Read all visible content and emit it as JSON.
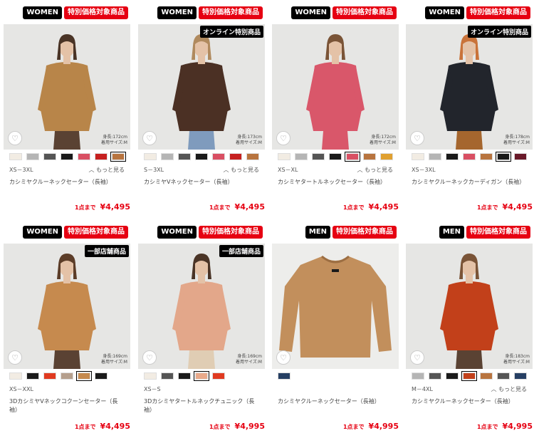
{
  "colors": {
    "accent": "#e60012",
    "badge_dark": "#000000"
  },
  "products": [
    {
      "gender_badge": "WOMEN",
      "promo_badge": "特別価格対象商品",
      "photo_tag": "",
      "model_height": "身長:172cm",
      "model_size": "着用サイズ:M",
      "swatches": [
        "#f2ece3",
        "#b5b5b5",
        "#555555",
        "#1a1a1a",
        "#d94f63",
        "#c62020",
        "#b8743f"
      ],
      "selected_swatch": 6,
      "size_range": "XS－3XL",
      "more_label": "もっと見る",
      "name": "カシミヤクルーネックセーター（長袖）",
      "limit_label": "1点まで",
      "price": "¥4,495",
      "photo": {
        "bg": "#e6e6e4",
        "top": "#b88549",
        "bottom": "#5a4233",
        "skin": "#e4c2a7",
        "hair": "#4a3426"
      }
    },
    {
      "gender_badge": "WOMEN",
      "promo_badge": "特別価格対象商品",
      "photo_tag": "オンライン特別商品",
      "model_height": "身長:173cm",
      "model_size": "着用サイズ:M",
      "swatches": [
        "#f2ece3",
        "#b5b5b5",
        "#555555",
        "#1a1a1a",
        "#d94f63",
        "#c62020",
        "#b8743f"
      ],
      "selected_swatch": -1,
      "size_range": "S－3XL",
      "more_label": "もっと見る",
      "name": "カシミヤVネックセーター（長袖）",
      "limit_label": "1点まで",
      "price": "¥4,495",
      "photo": {
        "bg": "#e6e6e4",
        "top": "#4b3024",
        "bottom": "#7f9bbd",
        "skin": "#e4c2a7",
        "hair": "#b08a5e"
      }
    },
    {
      "gender_badge": "WOMEN",
      "promo_badge": "特別価格対象商品",
      "photo_tag": "",
      "model_height": "身長:172cm",
      "model_size": "着用サイズ:M",
      "swatches": [
        "#f2ece3",
        "#b5b5b5",
        "#555555",
        "#1a1a1a",
        "#d94f63",
        "#b8743f",
        "#e0a030"
      ],
      "selected_swatch": 4,
      "size_range": "XS－XL",
      "more_label": "もっと見る",
      "name": "カシミヤタートルネックセーター（長袖）",
      "limit_label": "1点まで",
      "price": "¥4,495",
      "photo": {
        "bg": "#e6e6e4",
        "top": "#d9576a",
        "bottom": "#d9576a",
        "skin": "#e4c2a7",
        "hair": "#7a5437"
      }
    },
    {
      "gender_badge": "WOMEN",
      "promo_badge": "特別価格対象商品",
      "photo_tag": "オンライン特別商品",
      "model_height": "身長:178cm",
      "model_size": "着用サイズ:M",
      "swatches": [
        "#f2ece3",
        "#b5b5b5",
        "#1a1a1a",
        "#d94f63",
        "#b8743f",
        "#1a1a1a",
        "#6a1a2a"
      ],
      "selected_swatch": 5,
      "size_range": "XS－3XL",
      "more_label": "",
      "name": "カシミヤクルーネックカーディガン（長袖）",
      "limit_label": "1点まで",
      "price": "¥4,495",
      "photo": {
        "bg": "#e6e6e4",
        "top": "#22252c",
        "bottom": "#a5662e",
        "skin": "#e4c2a7",
        "hair": "#c9733a"
      }
    },
    {
      "gender_badge": "WOMEN",
      "promo_badge": "特別価格対象商品",
      "photo_tag": "一部店舗商品",
      "model_height": "身長:169cm",
      "model_size": "着用サイズ:M",
      "swatches": [
        "#f2ece3",
        "#1a1a1a",
        "#e03a20",
        "#b59f8d",
        "#c68a4e",
        "#1a1a1a"
      ],
      "selected_swatch": 4,
      "size_range": "XS－XXL",
      "more_label": "",
      "name": "3DカシミヤVネックコクーンセーター（長袖）",
      "limit_label": "1点まで",
      "price": "¥4,495",
      "photo": {
        "bg": "#e6e6e4",
        "top": "#c68a4e",
        "bottom": "#5a4233",
        "skin": "#e4c2a7",
        "hair": "#5c3d28"
      }
    },
    {
      "gender_badge": "WOMEN",
      "promo_badge": "特別価格対象商品",
      "photo_tag": "一部店舗商品",
      "model_height": "身長:169cm",
      "model_size": "着用サイズ:M",
      "swatches": [
        "#f2ece3",
        "#555555",
        "#1a1a1a",
        "#e9a98a",
        "#e03a20"
      ],
      "selected_swatch": 3,
      "size_range": "XS－S",
      "more_label": "",
      "name": "3Dカシミヤタートルネックチュニック（長袖）",
      "limit_label": "1点まで",
      "price": "¥4,995",
      "photo": {
        "bg": "#e6e6e4",
        "top": "#e3a78a",
        "bottom": "#e0cdb4",
        "skin": "#e4c2a7",
        "hair": "#4a3426"
      }
    },
    {
      "gender_badge": "MEN",
      "promo_badge": "特別価格対象商品",
      "photo_tag": "",
      "model_height": "",
      "model_size": "",
      "swatches": [
        "#263f63"
      ],
      "selected_swatch": -1,
      "size_range": "",
      "more_label": "",
      "name": "カシミヤクルーネックセーター（長袖）",
      "limit_label": "1点まで",
      "price": "¥4,995",
      "photo": {
        "bg": "#ededeb",
        "top": "#c28f5c",
        "bottom": "",
        "skin": "",
        "hair": ""
      }
    },
    {
      "gender_badge": "MEN",
      "promo_badge": "特別価格対象商品",
      "photo_tag": "",
      "model_height": "身長:183cm",
      "model_size": "着用サイズ:M",
      "swatches": [
        "#b5b5b5",
        "#555555",
        "#1a1a1a",
        "#c2401a",
        "#b8743f",
        "#555555",
        "#263f63"
      ],
      "selected_swatch": 3,
      "size_range": "M－4XL",
      "more_label": "もっと見る",
      "name": "カシミヤクルーネックセーター（長袖）",
      "limit_label": "1点まで",
      "price": "¥4,995",
      "photo": {
        "bg": "#e6e6e4",
        "top": "#c2401a",
        "bottom": "#5a4233",
        "skin": "#e4c2a7",
        "hair": "#7a5437"
      }
    }
  ]
}
